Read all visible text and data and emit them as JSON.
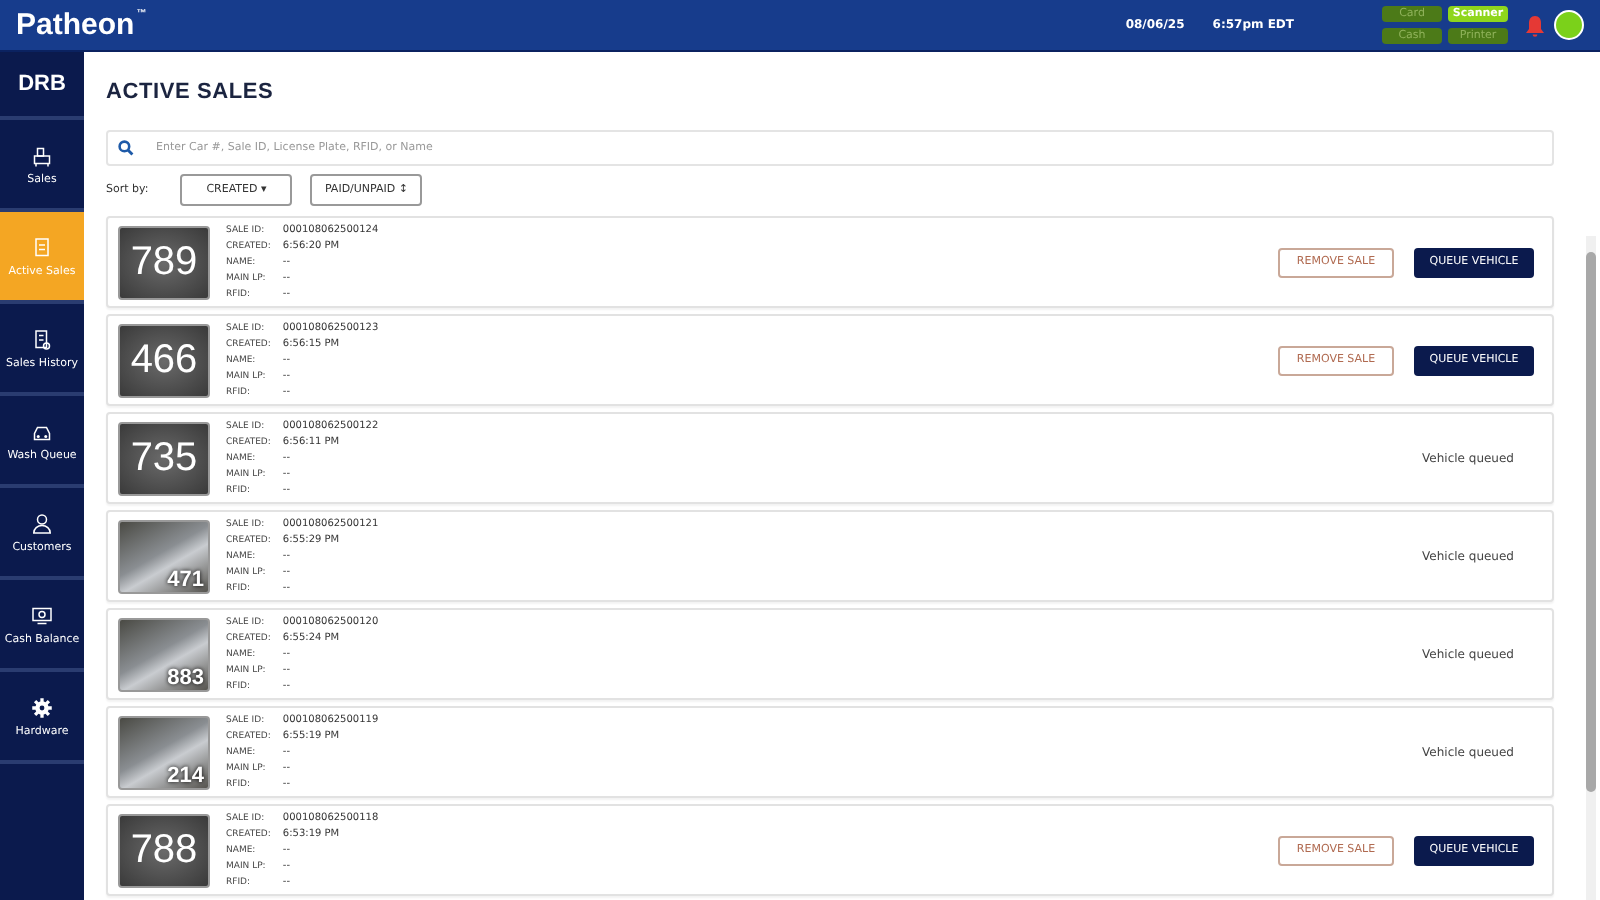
{
  "header": {
    "brand": "Patheon",
    "brand_mark": "™",
    "date": "08/06/25",
    "time": "6:57pm EDT",
    "devices": [
      {
        "label": "Card",
        "on": false
      },
      {
        "label": "Scanner",
        "on": true
      },
      {
        "label": "Cash",
        "on": false
      },
      {
        "label": "Printer",
        "on": false
      }
    ],
    "alert": true
  },
  "sidebar": {
    "logo": "DRB",
    "items": [
      {
        "label": "Sales",
        "selected": false
      },
      {
        "label": "Active Sales",
        "selected": true
      },
      {
        "label": "Sales History",
        "selected": false
      },
      {
        "label": "Wash Queue",
        "selected": false
      },
      {
        "label": "Customers",
        "selected": false
      },
      {
        "label": "Cash Balance",
        "selected": false
      },
      {
        "label": "Hardware",
        "selected": false
      }
    ]
  },
  "page": {
    "title": "ACTIVE SALES",
    "search": {
      "placeholder": "Enter Car #, Sale ID, License Plate, RFID, or Name"
    },
    "sort_label": "Sort by:",
    "sort_buttons": [
      {
        "label": "CREATED",
        "caret": "▾"
      },
      {
        "label": "PAID/UNPAID",
        "caret": "↕"
      }
    ]
  },
  "sales": [
    {
      "kind": "number",
      "car": "789",
      "fields": [
        {
          "label": "SALE ID:",
          "value": "000108062500124"
        },
        {
          "label": "CREATED:",
          "value": "6:56:20 PM"
        },
        {
          "label": "NAME:",
          "value": "--"
        },
        {
          "label": "MAIN LP:",
          "value": "--"
        },
        {
          "label": "RFID:",
          "value": "--"
        }
      ],
      "queued": false,
      "remove": "REMOVE SALE",
      "queue": "QUEUE VEHICLE"
    },
    {
      "kind": "number",
      "car": "466",
      "fields": [
        {
          "label": "SALE ID:",
          "value": "000108062500123"
        },
        {
          "label": "CREATED:",
          "value": "6:56:15 PM"
        },
        {
          "label": "NAME:",
          "value": "--"
        },
        {
          "label": "MAIN LP:",
          "value": "--"
        },
        {
          "label": "RFID:",
          "value": "--"
        }
      ],
      "queued": false,
      "remove": "REMOVE SALE",
      "queue": "QUEUE VEHICLE"
    },
    {
      "kind": "number",
      "car": "735",
      "fields": [
        {
          "label": "SALE ID:",
          "value": "000108062500122"
        },
        {
          "label": "CREATED:",
          "value": "6:56:11 PM"
        },
        {
          "label": "NAME:",
          "value": "--"
        },
        {
          "label": "MAIN LP:",
          "value": "--"
        },
        {
          "label": "RFID:",
          "value": "--"
        }
      ],
      "queued": true,
      "status": "Vehicle queued"
    },
    {
      "kind": "photo",
      "car": "471",
      "fields": [
        {
          "label": "SALE ID:",
          "value": "000108062500121"
        },
        {
          "label": "CREATED:",
          "value": "6:55:29 PM"
        },
        {
          "label": "NAME:",
          "value": "--"
        },
        {
          "label": "MAIN LP:",
          "value": "--"
        },
        {
          "label": "RFID:",
          "value": "--"
        }
      ],
      "queued": true,
      "status": "Vehicle queued"
    },
    {
      "kind": "photo",
      "car": "883",
      "fields": [
        {
          "label": "SALE ID:",
          "value": "000108062500120"
        },
        {
          "label": "CREATED:",
          "value": "6:55:24 PM"
        },
        {
          "label": "NAME:",
          "value": "--"
        },
        {
          "label": "MAIN LP:",
          "value": "--"
        },
        {
          "label": "RFID:",
          "value": "--"
        }
      ],
      "queued": true,
      "status": "Vehicle queued"
    },
    {
      "kind": "photo",
      "car": "214",
      "fields": [
        {
          "label": "SALE ID:",
          "value": "000108062500119"
        },
        {
          "label": "CREATED:",
          "value": "6:55:19 PM"
        },
        {
          "label": "NAME:",
          "value": "--"
        },
        {
          "label": "MAIN LP:",
          "value": "--"
        },
        {
          "label": "RFID:",
          "value": "--"
        }
      ],
      "queued": true,
      "status": "Vehicle queued"
    },
    {
      "kind": "number",
      "car": "788",
      "fields": [
        {
          "label": "SALE ID:",
          "value": "000108062500118"
        },
        {
          "label": "CREATED:",
          "value": "6:53:19 PM"
        },
        {
          "label": "NAME:",
          "value": "--"
        },
        {
          "label": "MAIN LP:",
          "value": "--"
        },
        {
          "label": "RFID:",
          "value": "--"
        }
      ],
      "queued": false,
      "remove": "REMOVE SALE",
      "queue": "QUEUE VEHICLE"
    }
  ]
}
